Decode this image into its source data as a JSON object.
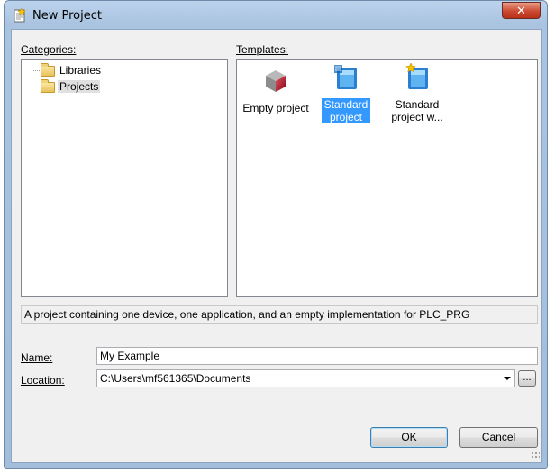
{
  "window": {
    "title": "New Project",
    "close_glyph": "✕"
  },
  "categories": {
    "label": "Categories:",
    "items": [
      {
        "label": "Libraries",
        "icon": "folder-icon",
        "selected": false
      },
      {
        "label": "Projects",
        "icon": "folder-icon",
        "selected": true
      }
    ]
  },
  "templates": {
    "label": "Templates:",
    "items": [
      {
        "label": "Empty project",
        "icon": "empty-project-icon",
        "selected": false
      },
      {
        "label": "Standard project",
        "icon": "standard-project-icon",
        "selected": true
      },
      {
        "label": "Standard project w...",
        "icon": "standard-project-wizard-icon",
        "selected": false
      }
    ]
  },
  "description": "A project containing one device, one application, and an empty implementation for PLC_PRG",
  "name_field": {
    "label": "Name:",
    "value": "My Example"
  },
  "location_field": {
    "label": "Location:",
    "value": "C:\\Users\\mf561365\\Documents",
    "browse_label": "..."
  },
  "buttons": {
    "ok": "OK",
    "cancel": "Cancel"
  },
  "colors": {
    "selection": "#3399ff",
    "close_button": "#cc4a31"
  }
}
